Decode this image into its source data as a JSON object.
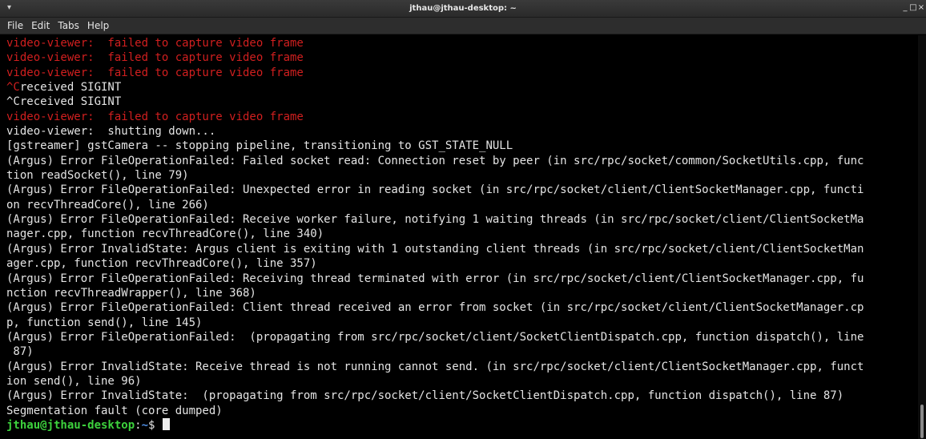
{
  "window": {
    "title": "jthau@jthau-desktop: ~",
    "wm_icon": "terminal-menu-icon",
    "controls": {
      "minimize": "_",
      "maximize": "□",
      "close": "×"
    }
  },
  "menu": [
    "File",
    "Edit",
    "Tabs",
    "Help"
  ],
  "terminal": {
    "lines": [
      {
        "text": "video-viewer:  failed to capture video frame",
        "color": "#d11f1f"
      },
      {
        "text": "video-viewer:  failed to capture video frame",
        "color": "#d11f1f"
      },
      {
        "text": "video-viewer:  failed to capture video frame",
        "color": "#d11f1f"
      },
      {
        "prefix": "^C",
        "prefix_color": "#d11f1f",
        "text": "received SIGINT"
      },
      {
        "text": "^Creceived SIGINT"
      },
      {
        "text": "video-viewer:  failed to capture video frame",
        "color": "#d11f1f"
      },
      {
        "text": "video-viewer:  shutting down..."
      },
      {
        "text": "[gstreamer] gstCamera -- stopping pipeline, transitioning to GST_STATE_NULL"
      },
      {
        "text": "(Argus) Error FileOperationFailed: Failed socket read: Connection reset by peer (in src/rpc/socket/common/SocketUtils.cpp, func"
      },
      {
        "text": "tion readSocket(), line 79)"
      },
      {
        "text": "(Argus) Error FileOperationFailed: Unexpected error in reading socket (in src/rpc/socket/client/ClientSocketManager.cpp, functi"
      },
      {
        "text": "on recvThreadCore(), line 266)"
      },
      {
        "text": "(Argus) Error FileOperationFailed: Receive worker failure, notifying 1 waiting threads (in src/rpc/socket/client/ClientSocketMa"
      },
      {
        "text": "nager.cpp, function recvThreadCore(), line 340)"
      },
      {
        "text": "(Argus) Error InvalidState: Argus client is exiting with 1 outstanding client threads (in src/rpc/socket/client/ClientSocketMan"
      },
      {
        "text": "ager.cpp, function recvThreadCore(), line 357)"
      },
      {
        "text": "(Argus) Error FileOperationFailed: Receiving thread terminated with error (in src/rpc/socket/client/ClientSocketManager.cpp, fu"
      },
      {
        "text": "nction recvThreadWrapper(), line 368)"
      },
      {
        "text": "(Argus) Error FileOperationFailed: Client thread received an error from socket (in src/rpc/socket/client/ClientSocketManager.cp"
      },
      {
        "text": "p, function send(), line 145)"
      },
      {
        "text": "(Argus) Error FileOperationFailed:  (propagating from src/rpc/socket/client/SocketClientDispatch.cpp, function dispatch(), line"
      },
      {
        "text": " 87)"
      },
      {
        "text": "(Argus) Error InvalidState: Receive thread is not running cannot send. (in src/rpc/socket/client/ClientSocketManager.cpp, funct"
      },
      {
        "text": "ion send(), line 96)"
      },
      {
        "text": "(Argus) Error InvalidState:  (propagating from src/rpc/socket/client/SocketClientDispatch.cpp, function dispatch(), line 87)"
      },
      {
        "text": "Segmentation fault (core dumped)"
      }
    ],
    "prompt": {
      "user_host": "jthau@jthau-desktop",
      "sep": ":",
      "path": "~",
      "symbol": "$ "
    },
    "colors": {
      "error": "#d11f1f",
      "normal": "#e4e4e4",
      "prompt_user": "#3dd13d",
      "prompt_path": "#4f8fe6"
    }
  }
}
